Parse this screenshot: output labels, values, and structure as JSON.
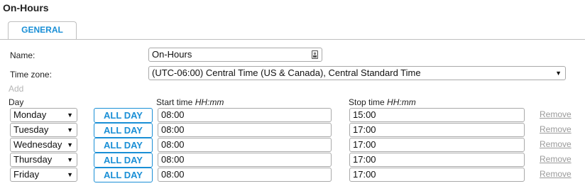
{
  "page_title": "On-Hours",
  "tabs": [
    {
      "label": "GENERAL",
      "active": true
    }
  ],
  "form": {
    "name_label": "Name:",
    "name_value": "On-Hours",
    "timezone_label": "Time zone:",
    "timezone_value": "(UTC-06:00) Central Time (US & Canada), Central Standard Time"
  },
  "schedule": {
    "add_label": "Add",
    "day_header": "Day",
    "start_header": "Start time ",
    "start_format": "HH:mm",
    "stop_header": "Stop time ",
    "stop_format": "HH:mm",
    "all_day_label": "ALL DAY",
    "remove_label": "Remove",
    "rows": [
      {
        "day": "Monday",
        "start": "08:00",
        "stop": "15:00"
      },
      {
        "day": "Tuesday",
        "start": "08:00",
        "stop": "17:00"
      },
      {
        "day": "Wednesday",
        "start": "08:00",
        "stop": "17:00"
      },
      {
        "day": "Thursday",
        "start": "08:00",
        "stop": "17:00"
      },
      {
        "day": "Friday",
        "start": "08:00",
        "stop": "17:00"
      }
    ]
  },
  "colors": {
    "accent": "#1a8fd6",
    "disabled": "#b5b5b5",
    "remove": "#9a9a9a"
  }
}
